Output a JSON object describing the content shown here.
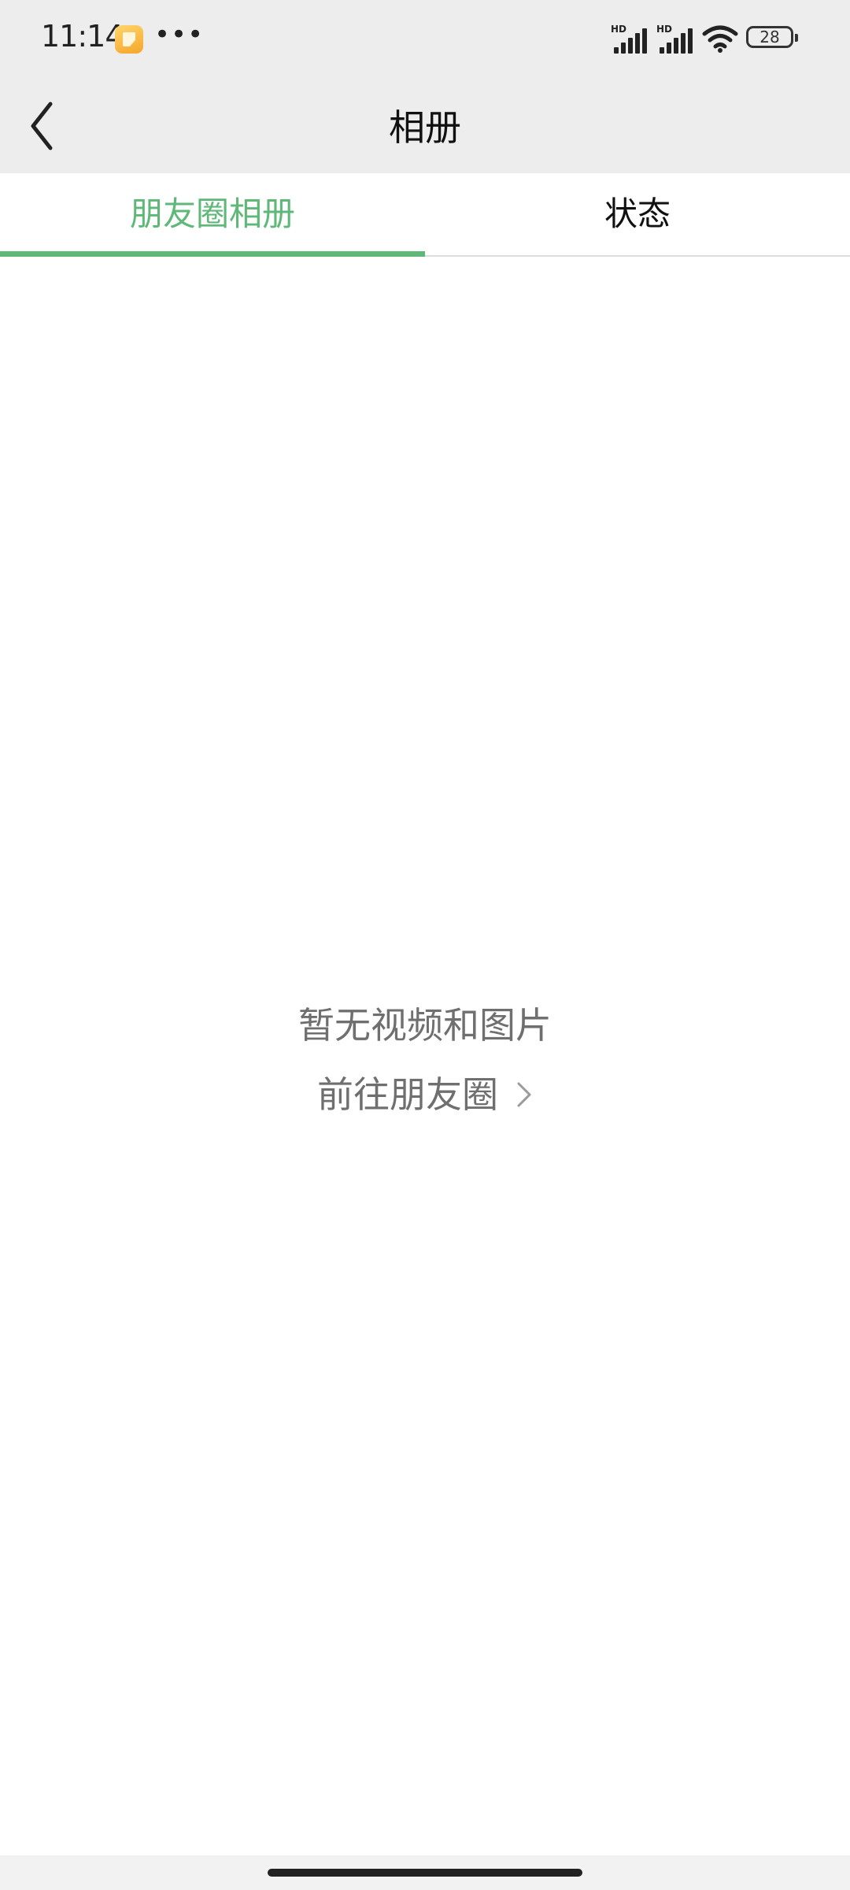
{
  "status_bar": {
    "time": "11:14",
    "more": "•••",
    "battery": "28",
    "signal_label": "HD",
    "icons": [
      "notification-app-icon",
      "signal-hd-icon",
      "signal-hd-icon",
      "wifi-icon",
      "battery-icon"
    ]
  },
  "header": {
    "title": "相册",
    "back_icon": "chevron-left-icon"
  },
  "tabs": [
    {
      "label": "朋友圈相册",
      "active": true
    },
    {
      "label": "状态",
      "active": false
    }
  ],
  "empty_state": {
    "message": "暂无视频和图片",
    "link_label": "前往朋友圈",
    "link_icon": "chevron-right-icon"
  },
  "colors": {
    "accent": "#5fb878",
    "header_bg": "#ededed",
    "secondary_text": "#6f6f6f"
  }
}
